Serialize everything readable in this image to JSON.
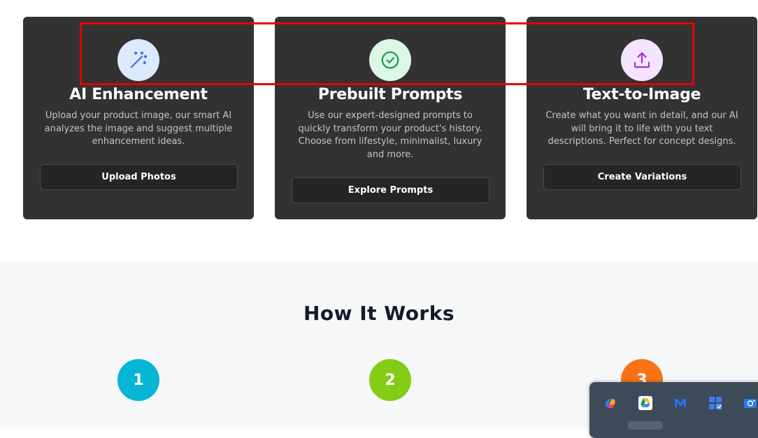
{
  "features": [
    {
      "icon": "magic-wand-icon",
      "title": "AI Enhancement",
      "description": "Upload your product image, our smart AI analyzes the image and suggest multiple enhancement ideas.",
      "button": "Upload Photos",
      "icon_bg": "#dde9fd",
      "icon_color": "#3b6fe0"
    },
    {
      "icon": "check-circle-icon",
      "title": "Prebuilt Prompts",
      "description": "Use our expert-designed prompts to quickly transform your product's history. Choose from lifestyle, minimalist, luxury and more.",
      "button": "Explore Prompts",
      "icon_bg": "#dcf7e5",
      "icon_color": "#1a9e48"
    },
    {
      "icon": "upload-icon",
      "title": "Text-to-Image",
      "description": "Create what you want in detail, and our AI will bring it to life with you text descriptions. Perfect for concept designs.",
      "button": "Create Variations",
      "icon_bg": "#f5e4fd",
      "icon_color": "#a235d8"
    }
  ],
  "how_it_works": {
    "title": "How It Works",
    "steps": [
      {
        "number": "1",
        "color": "#06b6d4"
      },
      {
        "number": "2",
        "color": "#84cc16"
      },
      {
        "number": "3",
        "color": "#f97316"
      }
    ]
  },
  "taskbar_tray": {
    "icons": [
      "copilot-icon",
      "google-drive-icon",
      "m-app-icon",
      "windows-widget-icon",
      "camera-app-icon"
    ]
  },
  "colors": {
    "highlight": "#e60000",
    "card_bg": "#333232",
    "section_bg": "#f6f7f9"
  }
}
